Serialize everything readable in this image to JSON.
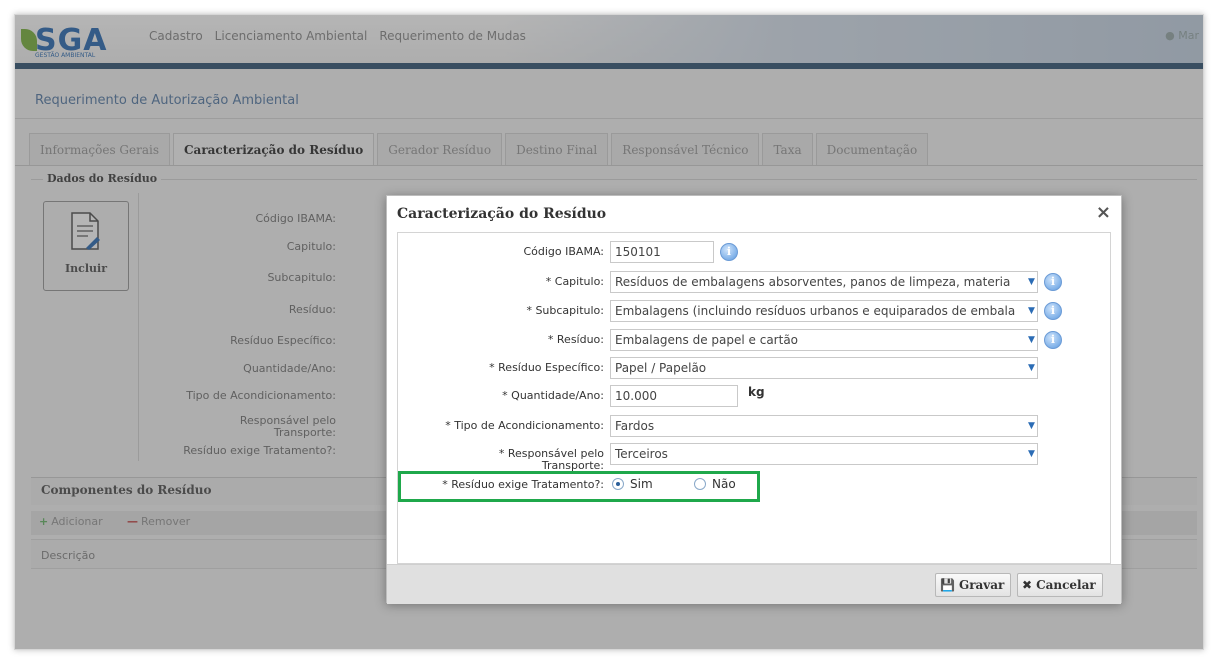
{
  "app": {
    "logo_text": "SGA",
    "logo_subtitle": "GESTÃO AMBIENTAL",
    "menu": [
      "Cadastro",
      "Licenciamento Ambiental",
      "Requerimento de Mudas"
    ],
    "user_short": "Mar"
  },
  "page": {
    "title": "Requerimento de Autorização Ambiental"
  },
  "tabs": [
    {
      "label": "Informações Gerais",
      "active": false
    },
    {
      "label": "Caracterização do Resíduo",
      "active": true
    },
    {
      "label": "Gerador Resíduo",
      "active": false
    },
    {
      "label": "Destino Final",
      "active": false
    },
    {
      "label": "Responsável Técnico",
      "active": false
    },
    {
      "label": "Taxa",
      "active": false
    },
    {
      "label": "Documentação",
      "active": false
    }
  ],
  "background_form": {
    "legend": "Dados do Resíduo",
    "include_button": "Incluir",
    "labels": [
      "Código IBAMA:",
      "Capitulo:",
      "Subcapitulo:",
      "Resíduo:",
      "Resíduo Específico:",
      "Quantidade/Ano:",
      "Tipo de Acondicionamento:",
      "Responsável pelo Transporte:",
      "Resíduo exige Tratamento?:"
    ]
  },
  "components": {
    "title": "Componentes do Resíduo",
    "add_label": "Adicionar",
    "remove_label": "Remover",
    "column_header": "Descrição"
  },
  "dialog": {
    "title": "Caracterização do Resíduo",
    "close_icon": "×",
    "fields": {
      "codigo_ibama": {
        "label": "Código IBAMA:",
        "value": "150101"
      },
      "capitulo": {
        "label": "* Capitulo:",
        "value": "Resíduos de embalagens absorventes, panos de limpeza, materia"
      },
      "subcapitulo": {
        "label": "* Subcapitulo:",
        "value": "Embalagens (incluindo resíduos urbanos e equiparados de embala"
      },
      "residuo": {
        "label": "* Resíduo:",
        "value": "Embalagens de papel e cartão"
      },
      "residuo_especifico": {
        "label": "* Resíduo Específico:",
        "value": "Papel / Papelão"
      },
      "quantidade": {
        "label": "* Quantidade/Ano:",
        "value": "10.000",
        "unit": "kg"
      },
      "acondicionamento": {
        "label": "* Tipo de Acondicionamento:",
        "value": "Fardos"
      },
      "transporte": {
        "label": "* Responsável pelo Transporte:",
        "value": "Terceiros"
      },
      "tratamento": {
        "label": "* Resíduo exige Tratamento?:",
        "options": [
          "Sim",
          "Não"
        ],
        "selected": "Sim"
      }
    },
    "buttons": {
      "save": "Gravar",
      "cancel": "Cancelar"
    }
  },
  "colors": {
    "header_accent": "#375a78",
    "highlight_box": "#1fa84b",
    "info_icon": "#5c9ae0"
  }
}
